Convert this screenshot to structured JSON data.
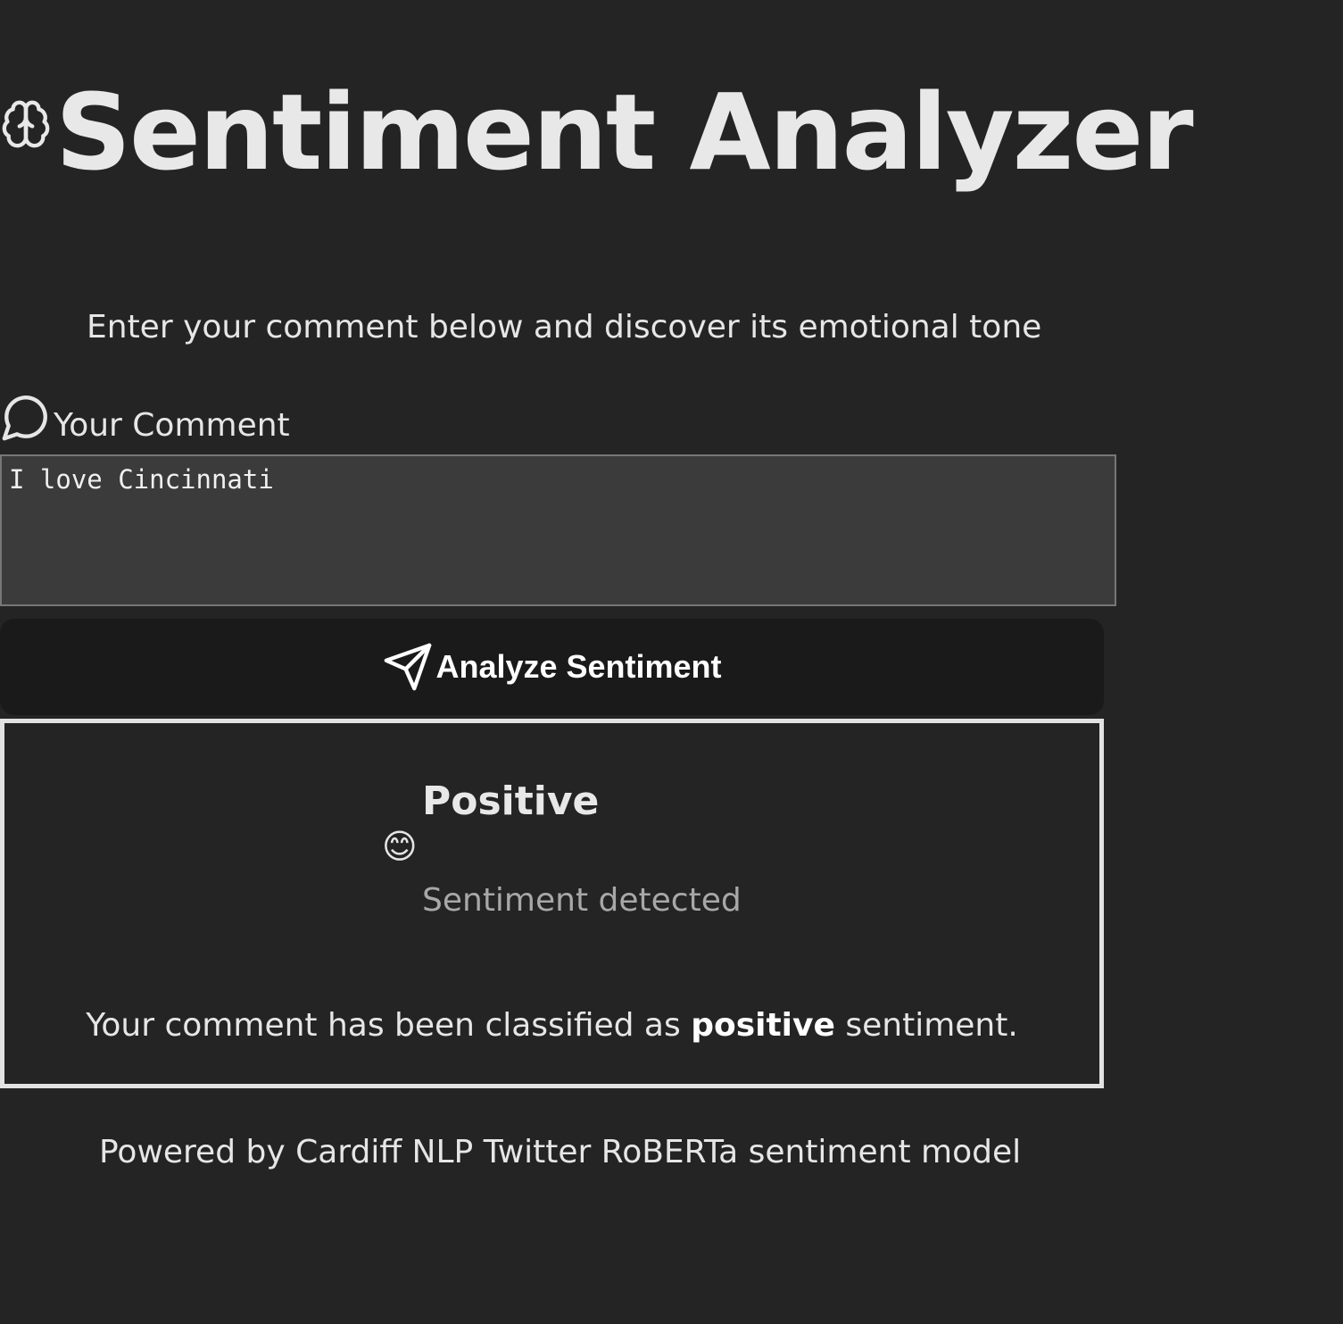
{
  "header": {
    "title": "Sentiment Analyzer",
    "icon": "brain-icon"
  },
  "subtitle": "Enter your comment below and discover its emotional tone",
  "comment": {
    "label": "Your Comment",
    "icon": "message-circle-icon",
    "value": "I love Cincinnati"
  },
  "analyze_button": {
    "label": "Analyze Sentiment",
    "icon": "send-icon"
  },
  "result": {
    "emoji": "😊",
    "label": "Positive",
    "detected_text": "Sentiment detected",
    "message_prefix": "Your comment has been classified as",
    "message_emphasis": "positive",
    "message_suffix": "sentiment."
  },
  "footer": "Powered by Cardiff NLP Twitter RoBERTa sentiment model",
  "colors": {
    "background": "#242424",
    "input_background": "#3b3b3b",
    "button_background": "#1a1a1a",
    "result_border": "#e2e2e2",
    "muted_text": "#a8a8a8"
  }
}
